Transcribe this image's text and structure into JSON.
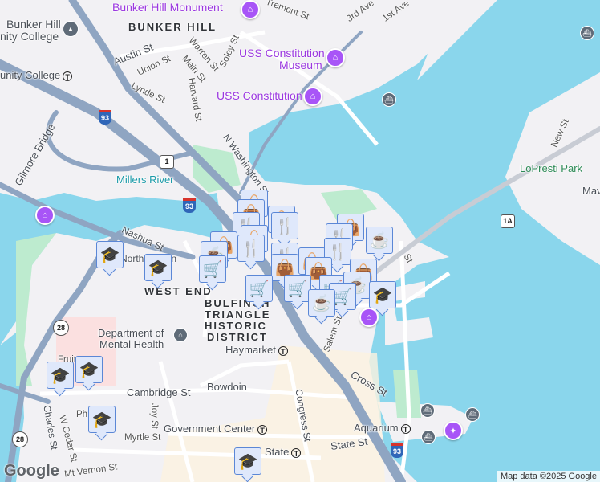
{
  "colors": {
    "water": "#8ad6ec",
    "land": "#f2f1f4",
    "park": "#bdebcf",
    "highway": "#8fa5c2",
    "road": "#ffffff",
    "poi": "#9b38e0",
    "marker_fill": "#dfe8fb",
    "marker_border": "#5b87d6",
    "marker_icon": "#0c3a5e"
  },
  "labels": {
    "bunker_hill_monument": "Bunker Hill Monument",
    "bhcc_line1": "Bunker Hill",
    "bhcc_line2": "nity College",
    "bunker_hill": "BUNKER HILL",
    "tremont": "Tremont St",
    "third_ave": "3rd Ave",
    "first_ave": "1st Ave",
    "austin": "Austin St",
    "union": "Union St",
    "warren": "Warren St",
    "main": "Main St",
    "soley": "Soley St",
    "harvard": "Harvard St",
    "lynde": "Lynde St",
    "uss_museum_1": "USS Constitution",
    "uss_museum_2": "Museum",
    "uss": "USS Constitution",
    "cc_station": "unity College",
    "gilmore": "Gilmore Bridge",
    "millers": "Millers River",
    "n_washington": "N Washington St",
    "lopresti": "LoPresti Park",
    "new_st": "New St",
    "mav": "Mav",
    "nashua": "Nashua St",
    "north_station": "North Station",
    "west_end": "WEST END",
    "bulfinch_1": "BULFINCH",
    "bulfinch_2": "TRIANGLE",
    "bulfinch_3": "HISTORIC",
    "bulfinch_4": "DISTRICT",
    "dmh_1": "Department of",
    "dmh_2": "Mental Health",
    "haymarket": "Haymarket",
    "cambridge": "Cambridge St",
    "bowdoin": "Bowdoin",
    "congress": "Congress St",
    "joy": "Joy St",
    "gov_center": "Government Center",
    "myrtle": "Myrtle St",
    "state_stop": "State",
    "mt_vernon": "Mt Vernon St",
    "charles": "Charles St",
    "w_cedar": "W Cedar St",
    "ph": "Ph",
    "fruit": "Fruit",
    "salem": "Salem St",
    "cross": "Cross St",
    "aquarium": "Aquarium",
    "state_st": "State St",
    "commercial": "St"
  },
  "shields": {
    "i93": "93",
    "us1": "1",
    "r28": "28",
    "r1a": "1A"
  },
  "marker_icons": {
    "school": "graduation-cap-icon",
    "restaurant": "fork-knife-icon",
    "shopping": "shopping-bag-icon",
    "grocery": "shopping-cart-icon",
    "cafe": "coffee-cup-icon"
  },
  "footer": {
    "logo": "Google",
    "attribution": "Map data ©2025 Google"
  }
}
